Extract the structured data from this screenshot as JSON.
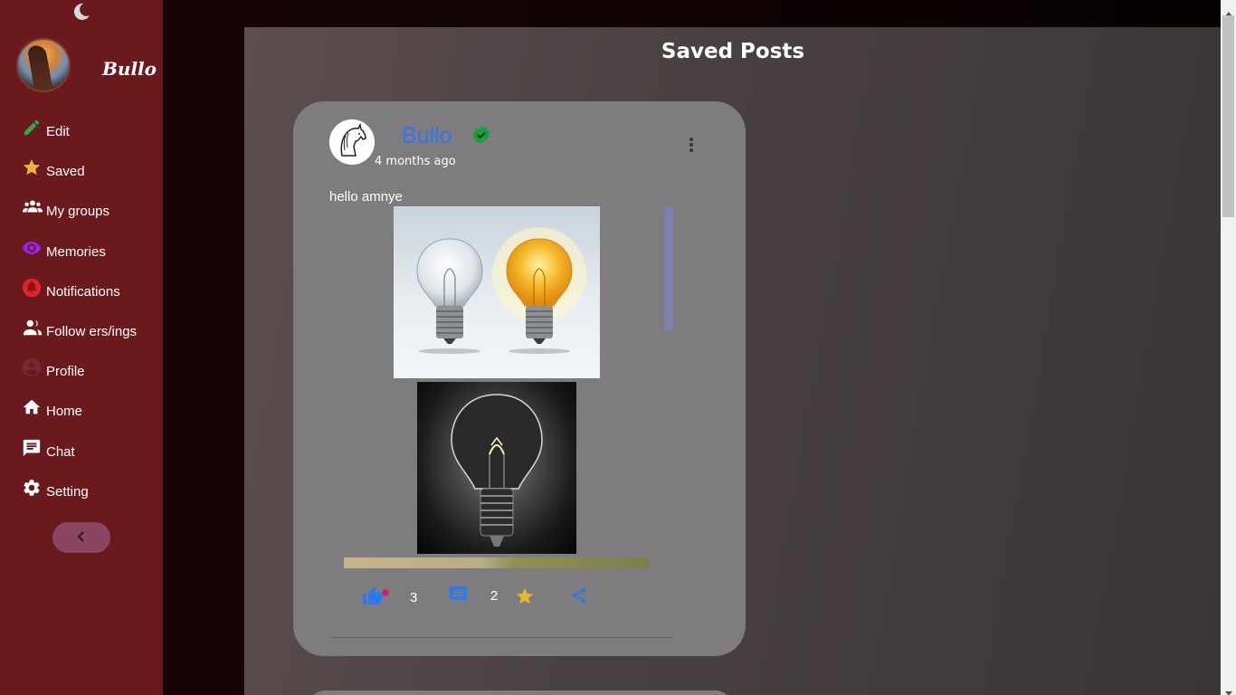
{
  "sidebar": {
    "profile_name": "Bullo",
    "items": [
      {
        "label": "Edit",
        "icon": "pencil-icon",
        "color": "#2ea84a"
      },
      {
        "label": "Saved",
        "icon": "star-icon",
        "color": "#e8b830"
      },
      {
        "label": "My groups",
        "icon": "group-icon",
        "color": "#ffffff"
      },
      {
        "label": "Memories",
        "icon": "eye-icon",
        "color": "#a020f0"
      },
      {
        "label": "Notifications",
        "icon": "bell-icon",
        "color": "#e0242c"
      },
      {
        "label": "Follow ers/ings",
        "icon": "people-icon",
        "color": "#ffffff"
      },
      {
        "label": "Profile",
        "icon": "account-circle-icon",
        "color": "#8a2a34"
      },
      {
        "label": "Home",
        "icon": "home-icon",
        "color": "#ffffff"
      },
      {
        "label": "Chat",
        "icon": "chat-icon",
        "color": "#ffffff"
      },
      {
        "label": "Setting",
        "icon": "gear-icon",
        "color": "#ffffff"
      }
    ]
  },
  "main": {
    "title": "Saved Posts",
    "post": {
      "author": "Bullo",
      "time": "4 months ago",
      "text": "hello amnye",
      "likes": "3",
      "comments": "2"
    }
  },
  "colors": {
    "sidebar_bg": "#6a1a1d",
    "accent_blue": "#2b78f0",
    "verified_green": "#15a03a",
    "like_dot": "#e6106a",
    "star": "#e8b830"
  }
}
